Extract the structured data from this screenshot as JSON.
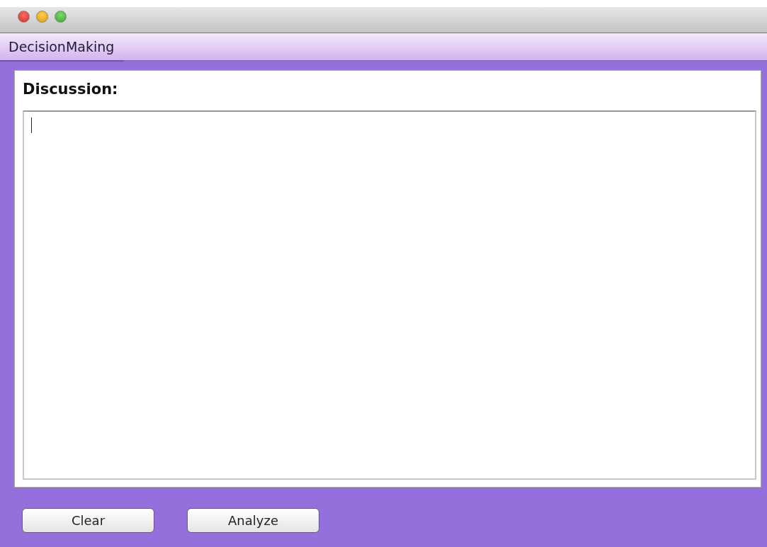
{
  "tabs": [
    {
      "label": "DecisionMaking",
      "selected": true
    }
  ],
  "panel": {
    "label": "Discussion:",
    "textarea": {
      "focused": true
    }
  },
  "buttons": [
    "Clear",
    "Analyze"
  ]
}
